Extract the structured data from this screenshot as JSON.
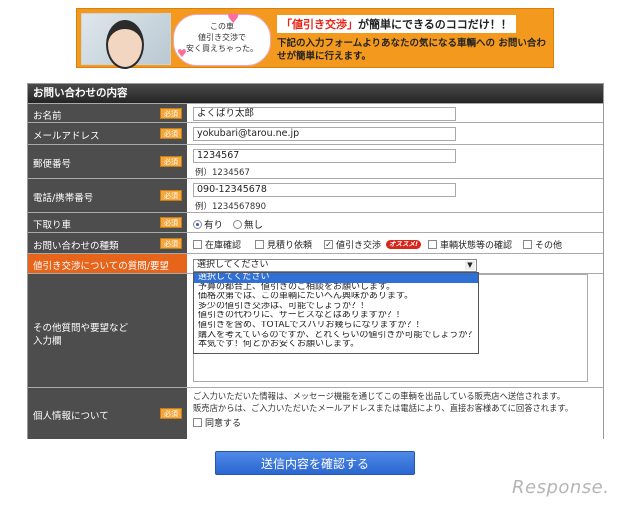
{
  "banner": {
    "bubble_lines": [
      "この車",
      "値引き交渉で",
      "安く買えちゃった。"
    ],
    "cap_highlight": "「値引き交渉」",
    "cap_rest": "が簡単にできるのココだけ！！",
    "cap_sub": "下記の入力フォームよりあなたの気になる車輌への お問い合わせが簡単に行えます。"
  },
  "form": {
    "header": "お問い合わせの内容",
    "required_label": "必須",
    "name": {
      "label": "お名前",
      "value": "よくばり太郎"
    },
    "email": {
      "label": "メールアドレス",
      "value": "yokubari@tarou.ne.jp"
    },
    "zip": {
      "label": "郵便番号",
      "value": "1234567",
      "hint": "例）1234567"
    },
    "phone": {
      "label": "電話/携帯番号",
      "value": "090-12345678",
      "hint": "例）1234567890"
    },
    "tradein": {
      "label": "下取り車",
      "options": [
        "有り",
        "無し"
      ],
      "selected": "有り"
    },
    "inquiry_type": {
      "label": "お問い合わせの種類",
      "options": [
        {
          "label": "在庫確認",
          "checked": false
        },
        {
          "label": "見積り依頼",
          "checked": false
        },
        {
          "label": "値引き交渉",
          "checked": true,
          "badge": "オススメ!"
        },
        {
          "label": "車輌状態等の確認",
          "checked": false
        },
        {
          "label": "その他",
          "checked": false
        }
      ]
    },
    "negotiation": {
      "label": "値引き交渉についての質問/要望",
      "selected": "選択してください",
      "options": [
        "選択してください",
        "予算の都合上、値引きのご相談をお願いします。",
        "価格次第では、この車輌にたいへん興味があります。",
        "多少の値引き交渉は、可能でしょうか？！",
        "値引きの代わりに、サービスなどはありますか？！",
        "値引きを含め、TOTALでズバリお幾らになりますか？！",
        "購入を考えているのですが、どれくらいの値引きが可能でしょうか？！",
        "本気です！何とかお安くお願いします。"
      ]
    },
    "other": {
      "label_line1": "その他質問や要望など",
      "label_line2": "入力欄"
    },
    "privacy": {
      "label": "個人情報について",
      "line1": "ご入力いただいた情報は、メッセージ機能を通じてこの車輌を出品している販売店へ送信されます。",
      "line2": "販売店からは、ご入力いただいたメールアドレスまたは電話により、直接お客様あてに回答されます。",
      "agree": "同意する"
    }
  },
  "submit_label": "送信内容を確認する",
  "logo_text": "Response."
}
